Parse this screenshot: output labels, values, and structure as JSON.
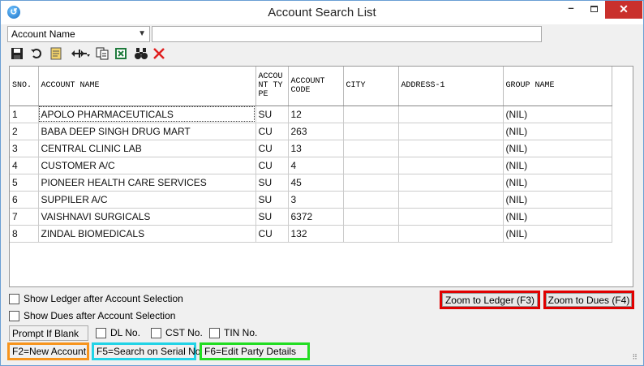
{
  "window": {
    "title": "Account Search List",
    "close_glyph": "✕",
    "minimize_glyph": "–"
  },
  "search": {
    "field_selected": "Account Name",
    "query": ""
  },
  "toolbar": {
    "icons": [
      "save-icon",
      "undo-icon",
      "report-icon",
      "column-resize-icon",
      "copy-icon",
      "excel-icon",
      "binoculars-icon",
      "delete-icon"
    ]
  },
  "grid": {
    "columns": [
      {
        "label": "SNO."
      },
      {
        "label": "ACCOUNT NAME"
      },
      {
        "label": "ACCOU NT TYPE"
      },
      {
        "label": "ACCOUNT CODE"
      },
      {
        "label": "CITY"
      },
      {
        "label": "ADDRESS-1"
      },
      {
        "label": "GROUP NAME"
      }
    ],
    "rows": [
      {
        "sno": "1",
        "name": "APOLO PHARMACEUTICALS",
        "type": "SU",
        "code": "12",
        "city": "",
        "address": "",
        "group": "(NIL)"
      },
      {
        "sno": "2",
        "name": "BABA DEEP SINGH DRUG MART",
        "type": "CU",
        "code": "263",
        "city": "",
        "address": "",
        "group": "(NIL)"
      },
      {
        "sno": "3",
        "name": "CENTRAL CLINIC LAB",
        "type": "CU",
        "code": "13",
        "city": "",
        "address": "",
        "group": "(NIL)"
      },
      {
        "sno": "4",
        "name": "CUSTOMER A/C",
        "type": "CU",
        "code": "4",
        "city": "",
        "address": "",
        "group": "(NIL)"
      },
      {
        "sno": "5",
        "name": "PIONEER HEALTH CARE SERVICES",
        "type": "SU",
        "code": "45",
        "city": "",
        "address": "",
        "group": "(NIL)"
      },
      {
        "sno": "6",
        "name": "SUPPILER A/C",
        "type": "SU",
        "code": "3",
        "city": "",
        "address": "",
        "group": "(NIL)"
      },
      {
        "sno": "7",
        "name": "VAISHNAVI SURGICALS",
        "type": "SU",
        "code": "6372",
        "city": "",
        "address": "",
        "group": "(NIL)"
      },
      {
        "sno": "8",
        "name": "ZINDAL BIOMEDICALS",
        "type": "CU",
        "code": "132",
        "city": "",
        "address": "",
        "group": "(NIL)"
      }
    ]
  },
  "options": {
    "show_ledger": "Show Ledger after Account Selection",
    "show_dues": "Show Dues after Account Selection",
    "prompt": "Prompt If Blank",
    "dl_no": "DL No.",
    "cst_no": "CST No.",
    "tin_no": "TIN No."
  },
  "buttons": {
    "zoom_ledger": "Zoom to Ledger (F3)",
    "zoom_dues": "Zoom to Dues (F4)"
  },
  "status": {
    "new_account": "F2=New Account",
    "search_serial": "F5=Search on Serial No",
    "edit_party": "F6=Edit Party Details"
  },
  "colors": {
    "new_account_border": "#f7941d",
    "search_serial_border": "#22d3e6",
    "edit_party_border": "#22dd22",
    "zoom_border": "#e00000"
  }
}
